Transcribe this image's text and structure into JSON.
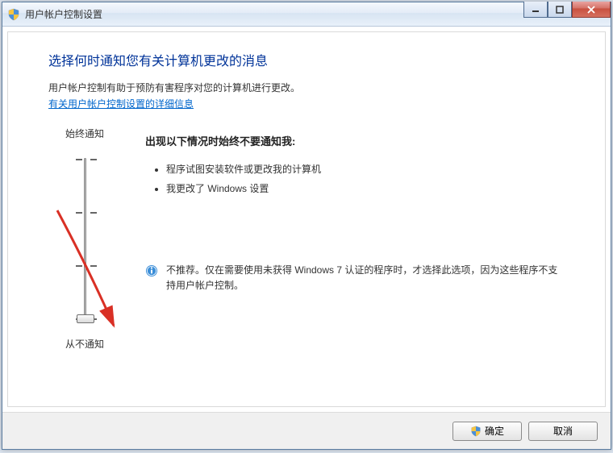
{
  "window": {
    "title": "用户帐户控制设置"
  },
  "heading": "选择何时通知您有关计算机更改的消息",
  "description": "用户帐户控制有助于预防有害程序对您的计算机进行更改。",
  "link_text": "有关用户帐户控制设置的详细信息",
  "slider": {
    "top_label": "始终通知",
    "bottom_label": "从不通知",
    "position": 3,
    "levels": 4
  },
  "detail": {
    "heading": "出现以下情况时始终不要通知我:",
    "bullets": [
      "程序试图安装软件或更改我的计算机",
      "我更改了 Windows 设置"
    ]
  },
  "info_text": "不推荐。仅在需要使用未获得 Windows 7 认证的程序时，才选择此选项，因为这些程序不支持用户帐户控制。",
  "buttons": {
    "ok": "确定",
    "cancel": "取消"
  }
}
